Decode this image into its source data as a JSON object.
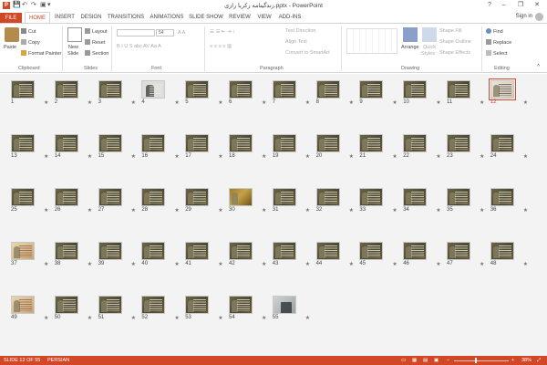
{
  "window": {
    "title": "‮زندگینامه زکریا رازی‬.pptx - PowerPoint",
    "app_icon": "P",
    "minimize": "–",
    "restore": "❐",
    "close": "✕",
    "help": "?"
  },
  "quick_access": {
    "save": "💾",
    "undo": "↶",
    "redo": "↷",
    "present": "▣",
    "customize": "▾"
  },
  "tabs": [
    {
      "label": "FILE"
    },
    {
      "label": "HOME"
    },
    {
      "label": "INSERT"
    },
    {
      "label": "DESIGN"
    },
    {
      "label": "TRANSITIONS"
    },
    {
      "label": "ANIMATIONS"
    },
    {
      "label": "SLIDE SHOW"
    },
    {
      "label": "REVIEW"
    },
    {
      "label": "VIEW"
    },
    {
      "label": "ADD-INS"
    }
  ],
  "signin": "Sign in",
  "ribbon": {
    "clipboard": {
      "paste": "Paste",
      "cut": "Cut",
      "copy": "Copy",
      "format_painter": "Format Painter",
      "label": "Clipboard"
    },
    "slides": {
      "new_slide": "New",
      "new_slide_2": "Slide",
      "layout": "Layout",
      "reset": "Reset",
      "section": "Section",
      "label": "Slides"
    },
    "font": {
      "size": "54",
      "label": "Font"
    },
    "paragraph": {
      "text_direction": "Text Direction",
      "align_text": "Align Text",
      "convert_smartart": "Convert to SmartArt",
      "label": "Paragraph"
    },
    "drawing": {
      "arrange": "Arrange",
      "quick_styles": "Quick",
      "quick_styles_2": "Styles",
      "shape_fill": "Shape Fill",
      "shape_outline": "Shape Outline",
      "shape_effects": "Shape Effects",
      "label": "Drawing"
    },
    "editing": {
      "find": "Find",
      "replace": "Replace",
      "select": "Select",
      "label": "Editing"
    }
  },
  "slides": [
    {
      "num": "1"
    },
    {
      "num": "2"
    },
    {
      "num": "3"
    },
    {
      "num": "4",
      "variant": "portrait"
    },
    {
      "num": "5"
    },
    {
      "num": "6"
    },
    {
      "num": "7"
    },
    {
      "num": "8"
    },
    {
      "num": "9"
    },
    {
      "num": "10"
    },
    {
      "num": "11"
    },
    {
      "num": "12",
      "variant": "light",
      "selected": true
    },
    {
      "num": "13"
    },
    {
      "num": "14"
    },
    {
      "num": "15"
    },
    {
      "num": "16"
    },
    {
      "num": "17"
    },
    {
      "num": "18"
    },
    {
      "num": "19"
    },
    {
      "num": "20"
    },
    {
      "num": "21"
    },
    {
      "num": "22"
    },
    {
      "num": "23"
    },
    {
      "num": "24"
    },
    {
      "num": "25"
    },
    {
      "num": "26"
    },
    {
      "num": "27"
    },
    {
      "num": "28"
    },
    {
      "num": "29"
    },
    {
      "num": "30",
      "variant": "gold"
    },
    {
      "num": "31"
    },
    {
      "num": "32"
    },
    {
      "num": "33"
    },
    {
      "num": "34"
    },
    {
      "num": "35"
    },
    {
      "num": "36"
    },
    {
      "num": "37",
      "variant": "parch"
    },
    {
      "num": "38"
    },
    {
      "num": "39"
    },
    {
      "num": "40"
    },
    {
      "num": "41"
    },
    {
      "num": "42"
    },
    {
      "num": "43"
    },
    {
      "num": "44"
    },
    {
      "num": "45"
    },
    {
      "num": "46"
    },
    {
      "num": "47"
    },
    {
      "num": "48"
    },
    {
      "num": "49",
      "variant": "parch"
    },
    {
      "num": "50"
    },
    {
      "num": "51"
    },
    {
      "num": "52"
    },
    {
      "num": "53"
    },
    {
      "num": "54"
    },
    {
      "num": "55",
      "variant": "photo"
    }
  ],
  "star_glyph": "★",
  "status": {
    "slide_info": "SLIDE 12 OF 55",
    "language": "PERSIAN",
    "zoom": "38%",
    "zoom_level": 0.38
  },
  "colors": {
    "accent": "#d24726",
    "sorter_bg": "#f3f3f3"
  }
}
